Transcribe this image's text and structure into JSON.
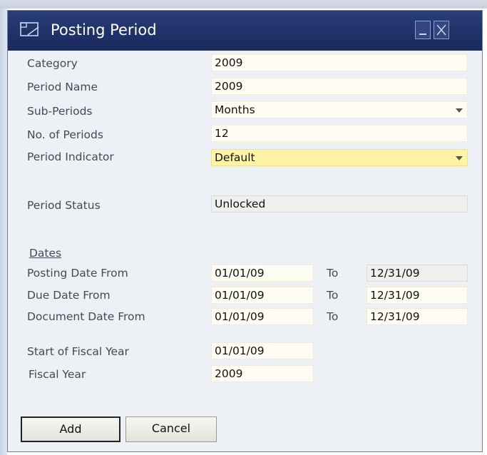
{
  "window": {
    "title": "Posting Period"
  },
  "form": {
    "category": {
      "label": "Category",
      "value": "2009"
    },
    "period_name": {
      "label": "Period Name",
      "value": "2009"
    },
    "sub_periods": {
      "label": "Sub-Periods",
      "value": "Months"
    },
    "no_of_periods": {
      "label": "No. of Periods",
      "value": "12"
    },
    "period_indicator": {
      "label": "Period Indicator",
      "value": "Default"
    },
    "period_status": {
      "label": "Period Status",
      "value": "Unlocked"
    }
  },
  "dates": {
    "section_title": "Dates",
    "to_label": "To",
    "posting": {
      "label": "Posting Date From",
      "from": "01/01/09",
      "to": "12/31/09"
    },
    "due": {
      "label": "Due Date From",
      "from": "01/01/09",
      "to": "12/31/09"
    },
    "document": {
      "label": "Document Date From",
      "from": "01/01/09",
      "to": "12/31/09"
    }
  },
  "fiscal": {
    "start": {
      "label": "Start of Fiscal Year",
      "value": "01/01/09"
    },
    "year": {
      "label": "Fiscal Year",
      "value": "2009"
    }
  },
  "buttons": {
    "add": "Add",
    "cancel": "Cancel"
  },
  "icons": {
    "title_icon": "form-window-icon",
    "minimize": "minimize-icon",
    "close": "close-icon"
  },
  "colors": {
    "titlebar": "#1f3166",
    "form_bg": "#edf0f5",
    "field_bg": "#fffdf3",
    "mandatory_field_bg": "#fff3a6"
  }
}
